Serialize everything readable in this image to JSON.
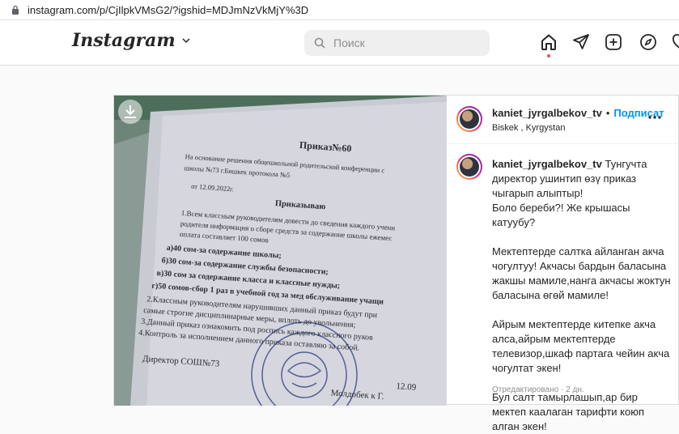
{
  "browser": {
    "url": "instagram.com/p/CjIlpkVMsG2/?igshid=MDJmNzVkMjY%3D"
  },
  "header": {
    "logo": "Instagram",
    "search_placeholder": "Поиск"
  },
  "post": {
    "username": "kaniet_jyrgalbekov_tv",
    "follow_label": "Подписат",
    "location": "Biskek , Kyrgystan",
    "caption_lines": [
      "Тунгучта директор ушинтип өзү приказ чыгарып алыптыр!",
      "Боло береби?! Же крышасы катуубу?",
      "",
      "Мектептерде салтка айланган акча чогултуу! Акчасы бардын баласына жакшы мамиле,нанга акчасы жоктун баласына өгөй мамиле!",
      "",
      "Айрым мектептерде китепке акча алса,айрым мектептерде телевизор,шкаф партага чейин акча чогултат экен!",
      "",
      "Бул салт тамырлашып,ар бир мектеп каалаган тарифти коюп алган экен!"
    ],
    "meta": "Отредактировано · 2 дн.",
    "document": {
      "title": "Приказ№60",
      "line1": "На основание решения общешкольной родительской конференции с",
      "line2": "школы №73 г.Бишкек протокола №5",
      "line3": "от 12.09.2022г.",
      "heading": "Приказываю",
      "p1": "1.Всем классным руководителям довести до сведения каждого учени",
      "p2": "родителя информация о сборе средств за содержание школы ежемес",
      "p3": "оплата составляет 100 сомов",
      "a": "а)40 сом-за содержание школы;",
      "b": "б)30 сом-за содержание службы безопасности;",
      "c": "в)30 сом за содержание класса и классные нужды;",
      "d": "г)50 сомов-сбор 1 раз в учебной год за мед обслуживание учащи",
      "p4": "2.Классным руководителям нарушивших данный приказ будут при",
      "p5": "самые строгие дисциплинарные меры, вплоть до увольнения;",
      "p6": "3.Данный приказ ознакомить под роспись каждого классного руков",
      "p7": "4.Контроль за исполнением данного приказа оставляю за собой.",
      "sign1": "Директор СОШ№73",
      "date": "12.09",
      "sign2": "Молдобек к Г."
    }
  }
}
